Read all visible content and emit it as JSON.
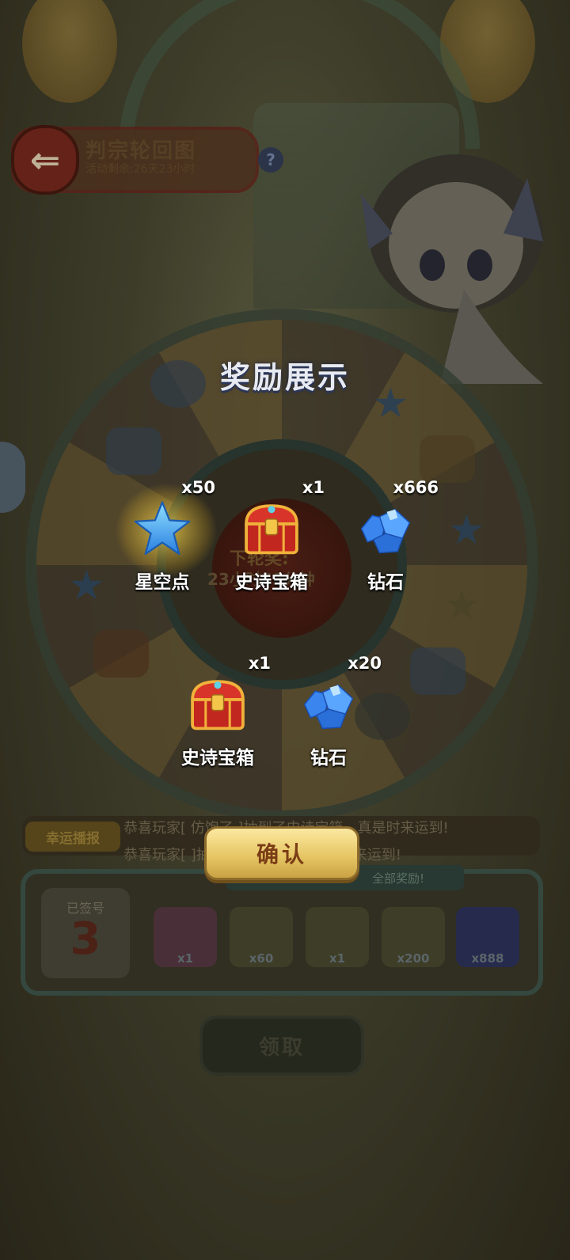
{
  "header": {
    "title": "判宗轮回图",
    "subtitle": "活动剩余:26天23小时",
    "help_label": "?"
  },
  "wheel": {
    "line1": "下轮奖:",
    "line2": "23小时59分钟"
  },
  "ticker": {
    "tag": "幸运播报",
    "lines": [
      "恭喜玩家[ 仿饱了 ]抽到了史诗宝箱，真是时来运到!",
      "恭喜玩家[ ]抽到了史诗宝箱，真是时来运到!"
    ]
  },
  "login_panel": {
    "banner": "全部奖励!",
    "day_label": "已签号",
    "day_number": "3",
    "items": [
      {
        "count": "x1"
      },
      {
        "count": "x60"
      },
      {
        "count": "x1"
      },
      {
        "count": "x200"
      },
      {
        "count": "x888"
      }
    ],
    "claim_label": "领取"
  },
  "popup": {
    "title": "奖励展示",
    "rewards": [
      {
        "name": "星空点",
        "count": "x50",
        "icon": "star-icon"
      },
      {
        "name": "史诗宝箱",
        "count": "x1",
        "icon": "treasure-chest-icon"
      },
      {
        "name": "钻石",
        "count": "x666",
        "icon": "diamond-icon"
      },
      {
        "name": "史诗宝箱",
        "count": "x1",
        "icon": "treasure-chest-icon"
      },
      {
        "name": "钻石",
        "count": "x20",
        "icon": "diamond-icon"
      }
    ],
    "confirm_label": "确认"
  }
}
